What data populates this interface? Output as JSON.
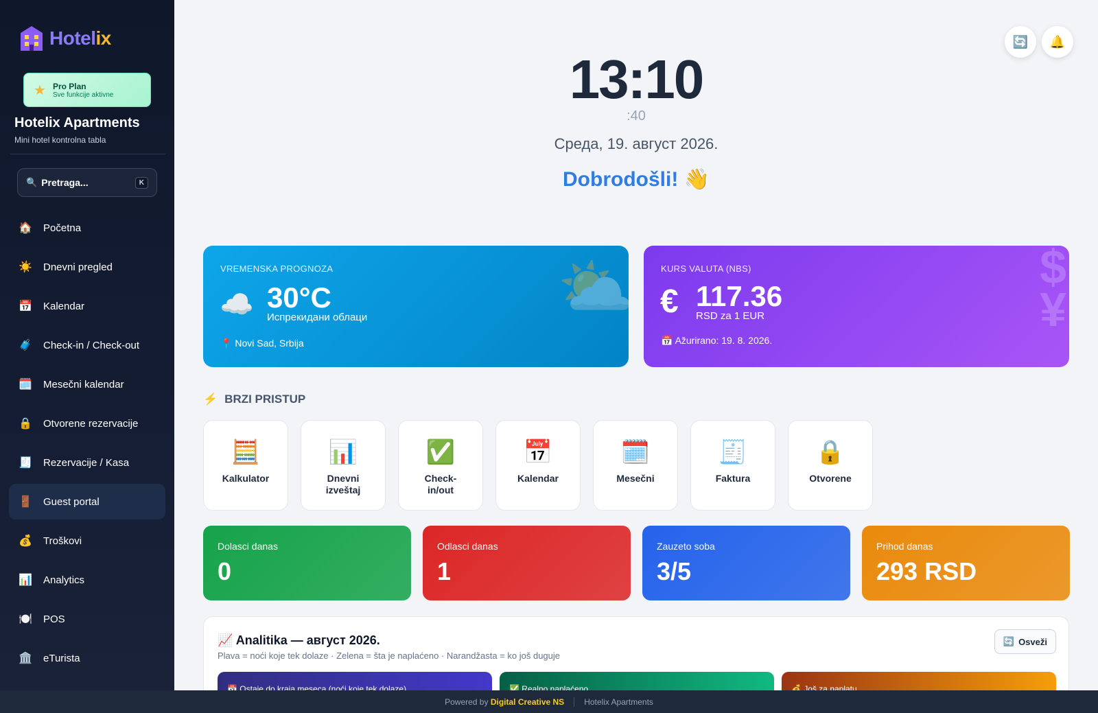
{
  "brand": {
    "logo_part1": "Hotel",
    "logo_part2": "ix"
  },
  "plan": {
    "title": "Pro Plan",
    "subtitle": "Sve funkcije aktivne"
  },
  "hotel": {
    "name": "Hotelix Apartments",
    "subtitle": "Mini hotel kontrolna tabla"
  },
  "search": {
    "label": "Pretraga...",
    "shortcut": "K"
  },
  "sidebar": {
    "items": [
      {
        "icon": "🏠",
        "label": "Početna"
      },
      {
        "icon": "☀️",
        "label": "Dnevni pregled"
      },
      {
        "icon": "📅",
        "label": "Kalendar"
      },
      {
        "icon": "🧳",
        "label": "Check-in / Check-out"
      },
      {
        "icon": "🗓️",
        "label": "Mesečni kalendar"
      },
      {
        "icon": "🔒",
        "label": "Otvorene rezervacije"
      },
      {
        "icon": "🧾",
        "label": "Rezervacije / Kasa"
      },
      {
        "icon": "🚪",
        "label": "Guest portal",
        "active": true
      },
      {
        "icon": "💰",
        "label": "Troškovi"
      },
      {
        "icon": "📊",
        "label": "Analytics"
      },
      {
        "icon": "🍽️",
        "label": "POS"
      },
      {
        "icon": "🏛️",
        "label": "eTurista"
      }
    ]
  },
  "clock": {
    "time": "13:10",
    "seconds": ":40",
    "date": "Среда, 19. август 2026.",
    "greeting": "Dobrodošli! 👋"
  },
  "weather": {
    "label": "VREMENSKA PROGNOZA",
    "icon": "☁️",
    "temp": "30°C",
    "desc": "Испрекидани облаци",
    "location": "Novi Sad, Srbija"
  },
  "currency": {
    "label": "KURS VALUTA (NBS)",
    "symbol": "€",
    "rate": "117.36",
    "unit": "RSD za 1 EUR",
    "updated": "Ažurirano: 19. 8. 2026."
  },
  "quick": {
    "title": "BRZI PRISTUP",
    "items": [
      {
        "icon": "🧮",
        "label": "Kalkulator"
      },
      {
        "icon": "📊",
        "label": "Dnevni izveštaj"
      },
      {
        "icon": "✅",
        "label": "Check-in/out"
      },
      {
        "icon": "📅",
        "label": "Kalendar"
      },
      {
        "icon": "🗓️",
        "label": "Mesečni"
      },
      {
        "icon": "🧾",
        "label": "Faktura"
      },
      {
        "icon": "🔒",
        "label": "Otvorene"
      }
    ]
  },
  "stats": [
    {
      "label": "Dolasci danas",
      "value": "0",
      "color": "#16a34a"
    },
    {
      "label": "Odlasci danas",
      "value": "1",
      "color": "#dc2626"
    },
    {
      "label": "Zauzeto soba",
      "value": "3/5",
      "color": "#2563eb"
    },
    {
      "label": "Prihod danas",
      "value": "293 RSD",
      "color": "#ea8a0c"
    }
  ],
  "analytics": {
    "title": "Analitika — август 2026.",
    "subtitle": "Plava = noći koje tek dolaze · Zelena = šta je naplaćeno · Narandžasta = ko još duguje",
    "refresh": "Osveži",
    "cards": [
      "Ostaje do kraja meseca (noći koje tek dolaze)",
      "Realno naplaćeno",
      "Još za naplatu"
    ]
  },
  "footer": {
    "powered": "Powered by",
    "company": "Digital Creative NS",
    "app": "Hotelix Apartments"
  }
}
